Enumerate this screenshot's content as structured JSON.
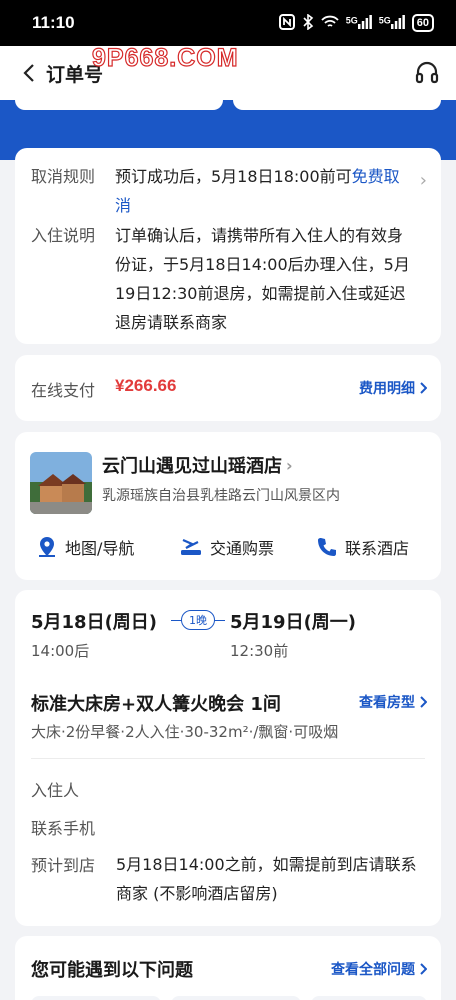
{
  "status_bar": {
    "time": "11:10",
    "icons": [
      "nfc-icon",
      "bluetooth-icon",
      "wifi-icon",
      "signal-5g-icon",
      "signal-5g-icon"
    ],
    "net1": "5G",
    "net2": "5G",
    "battery": "60"
  },
  "header": {
    "title": "订单号",
    "watermark": "9P668.COM"
  },
  "policy": {
    "cancel_label": "取消规则",
    "cancel_text": "预订成功后，5月18日18:00前可",
    "cancel_free": "免费取消",
    "checkin_label": "入住说明",
    "checkin_text": "订单确认后，请携带所有入住人的有效身份证，于5月18日14:00后办理入住，5月19日12:30前退房，如需提前入住或延迟退房请联系商家"
  },
  "payment": {
    "label": "在线支付",
    "price": "¥266.66",
    "detail_link": "费用明细"
  },
  "hotel": {
    "name": "云门山遇见过山瑶酒店",
    "address": "乳源瑶族自治县乳桂路云门山风景区内",
    "actions": {
      "map": "地图/导航",
      "transport": "交通购票",
      "contact": "联系酒店"
    }
  },
  "stay": {
    "checkin_date": "5月18日(周日)",
    "checkin_time": "14:00后",
    "nights": "1晚",
    "checkout_date": "5月19日(周一)",
    "checkout_time": "12:30前",
    "room_name": "标准大床房+双人篝火晚会 1间",
    "room_type_link": "查看房型",
    "room_desc": "大床·2份早餐·2人入住·30-32m²·/飘窗·可吸烟",
    "guest_label": "入住人",
    "phone_label": "联系手机",
    "arrive_label": "预计到店",
    "arrive_text": "5月18日14:00之前，如需提前到店请联系商家 (不影响酒店留房)"
  },
  "faq": {
    "title": "您可能遇到以下问题",
    "link": "查看全部问题"
  },
  "colors": {
    "accent": "#1b57c6",
    "price": "#e23b3b",
    "background": "#f2f3f6"
  }
}
